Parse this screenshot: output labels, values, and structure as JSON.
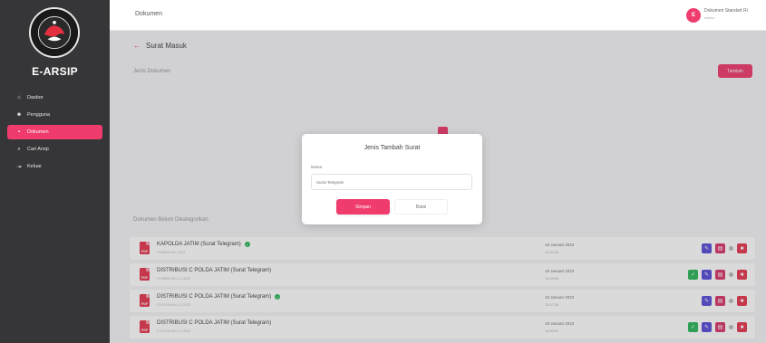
{
  "sidebar": {
    "brand": "E-ARSIP",
    "items": [
      {
        "label": "Dasbor",
        "icon": "home-icon",
        "glyph": "⌂"
      },
      {
        "label": "Pengguna",
        "icon": "users-icon",
        "glyph": "☻"
      },
      {
        "label": "Dokumen",
        "icon": "document-icon",
        "glyph": "▪"
      },
      {
        "label": "Cari Arsip",
        "icon": "search-icon",
        "glyph": "⌕"
      },
      {
        "label": "Keluar",
        "icon": "logout-icon",
        "glyph": "⇥"
      }
    ]
  },
  "header": {
    "title": "Dokumen",
    "user": {
      "initial": "E",
      "name": "Dokumen Standart Ri",
      "role": "Admin"
    }
  },
  "main": {
    "back_title": "Surat Masuk",
    "jenis_label": "Jenis Dokumen",
    "tambah_label": "Tambah",
    "uncategorized_label": "Dokumen Belum Dikategorikan",
    "documents": [
      {
        "title": "KAPOLDA JATIM (Surat Telegram)",
        "sub": "ST/066/I/HUK./2023",
        "date": "19 Januari 2023",
        "time": "11:32:42",
        "verified": true,
        "approve": false
      },
      {
        "title": "DISTRIBUSI C POLDA JATIM (Surat Telegram)",
        "sub": "ST/068/I/HUK.4.1./2023",
        "date": "19 Januari 2023",
        "time": "11:09:51",
        "verified": false,
        "approve": true
      },
      {
        "title": "DISTRIBUSI C POLDA JATIM (Surat Telegram)",
        "sub": "ST/070/I/HUK.4.1./2023",
        "date": "19 Januari 2023",
        "time": "11:07:30",
        "verified": true,
        "approve": false
      },
      {
        "title": "DISTRIBUSI C POLDA JATIM (Surat Telegram)",
        "sub": "ST/071/I/HUK.4.1./2023",
        "date": "19 Januari 2023",
        "time": "11:09:51",
        "verified": false,
        "approve": true
      }
    ]
  },
  "modal": {
    "title": "Jenis Tambah Surat",
    "name_label": "Nama",
    "name_value": "Surat Telegram",
    "save_label": "Simpan",
    "cancel_label": "Batal"
  },
  "colors": {
    "accent": "#ef3c6d",
    "sidebar": "#363638",
    "success": "#2eb85c",
    "edit": "#5a4fd8",
    "delete": "#e63950"
  }
}
